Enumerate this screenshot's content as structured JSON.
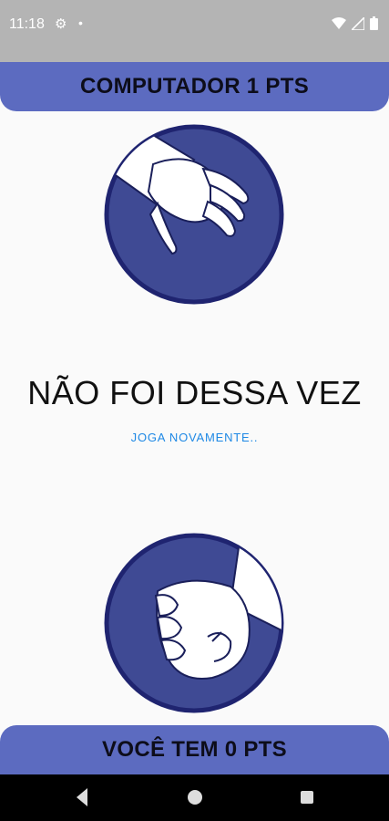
{
  "status_bar": {
    "time": "11:18",
    "icons": [
      "gear-icon",
      "notification-dot",
      "wifi-icon",
      "signal-icon",
      "battery-icon"
    ]
  },
  "score": {
    "computer": "COMPUTADOR 1 PTS",
    "player": "VOCÊ TEM 0 PTS"
  },
  "result": {
    "title": "NÃO FOI DESSA VEZ",
    "play_again": "JOGA NOVAMENTE.."
  },
  "choices": {
    "computer": "paper-hand-icon",
    "player": "rock-fist-icon"
  },
  "colors": {
    "accent": "#5c6bc0",
    "circle_fill": "#3f4a94",
    "circle_border": "#1f2470",
    "link": "#1e88e5"
  },
  "nav_bar": {
    "buttons": [
      "back-icon",
      "home-icon",
      "recents-icon"
    ]
  }
}
